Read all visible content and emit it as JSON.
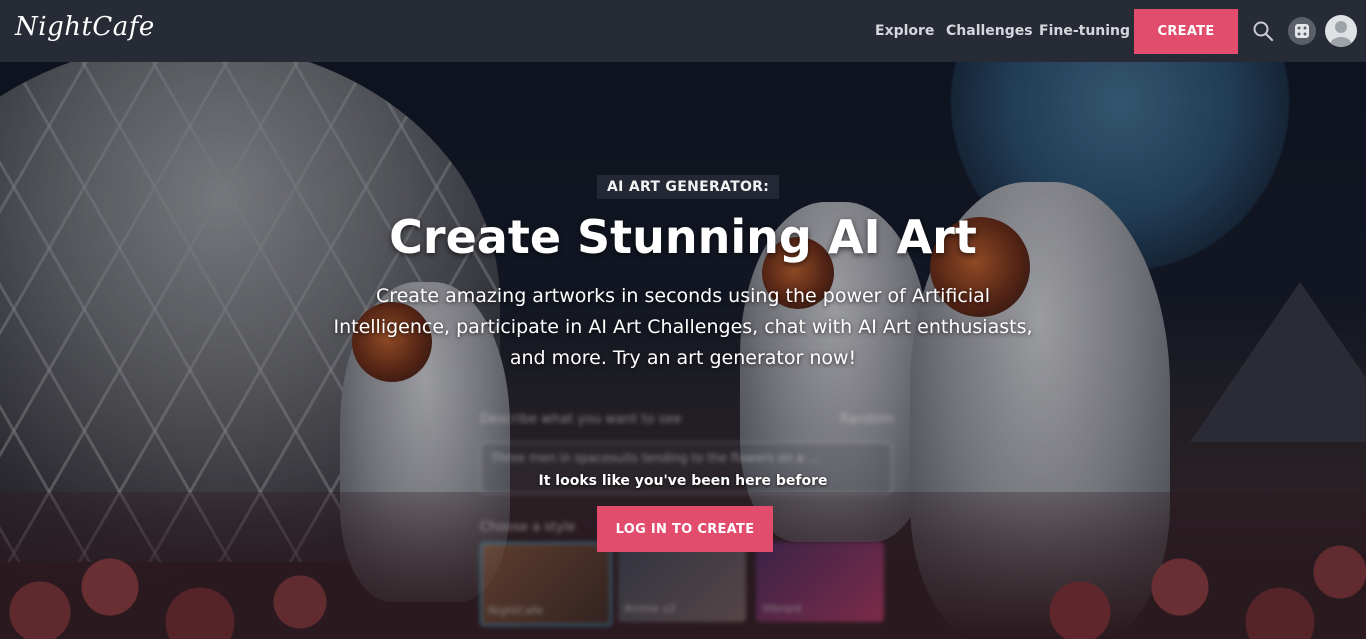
{
  "nav": {
    "logo": "NightCafe",
    "links": [
      "Explore",
      "Challenges",
      "Fine-tuning"
    ],
    "create_label": "CREATE"
  },
  "hero": {
    "badge": "AI ART GENERATOR:",
    "headline": "Create Stunning AI Art",
    "subtitle": "Create amazing artworks in seconds using the power of Artificial Intelligence, participate in AI Art Challenges, chat with AI Art enthusiasts, and more. Try an art generator now!",
    "been_here": "It looks like you've been here before",
    "login_label": "LOG IN TO CREATE"
  },
  "ghost_form": {
    "prompt_label": "Describe what you want to see",
    "random_label": "Random",
    "prompt_value": "Three men in spacesuits tending to the flowers on a ...",
    "style_label": "Choose a style",
    "styles": [
      "NightCafe",
      "Anime v2",
      "Vibrant"
    ]
  },
  "colors": {
    "accent": "#e24d6d",
    "nav_bg": "#272b35"
  }
}
